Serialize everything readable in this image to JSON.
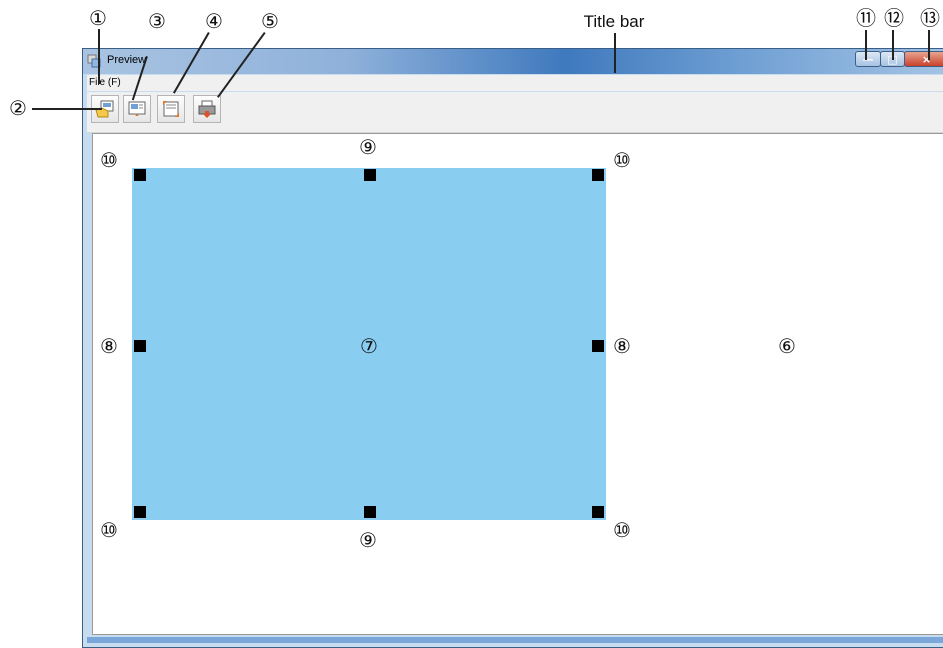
{
  "annotations": {
    "title_bar": "Title bar",
    "n1": "①",
    "n2": "②",
    "n3": "③",
    "n4": "④",
    "n5": "⑤",
    "n6": "⑥",
    "n7": "⑦",
    "n8": "⑧",
    "n9": "⑨",
    "n10": "⑩",
    "n11": "⑪",
    "n12": "⑫",
    "n13": "⑬"
  },
  "window": {
    "title": "Preview",
    "menu": {
      "file": "File (F)"
    },
    "controls": {
      "minimize": "—",
      "maximize": "□",
      "close": "×"
    }
  },
  "colors": {
    "page_area": "#89cdf1",
    "handle": "#000000",
    "titlebar_accent": "#3f79be"
  },
  "icons": {
    "toolbar": [
      "open-file-icon",
      "page-setup-icon",
      "fit-page-icon",
      "print-icon"
    ]
  }
}
